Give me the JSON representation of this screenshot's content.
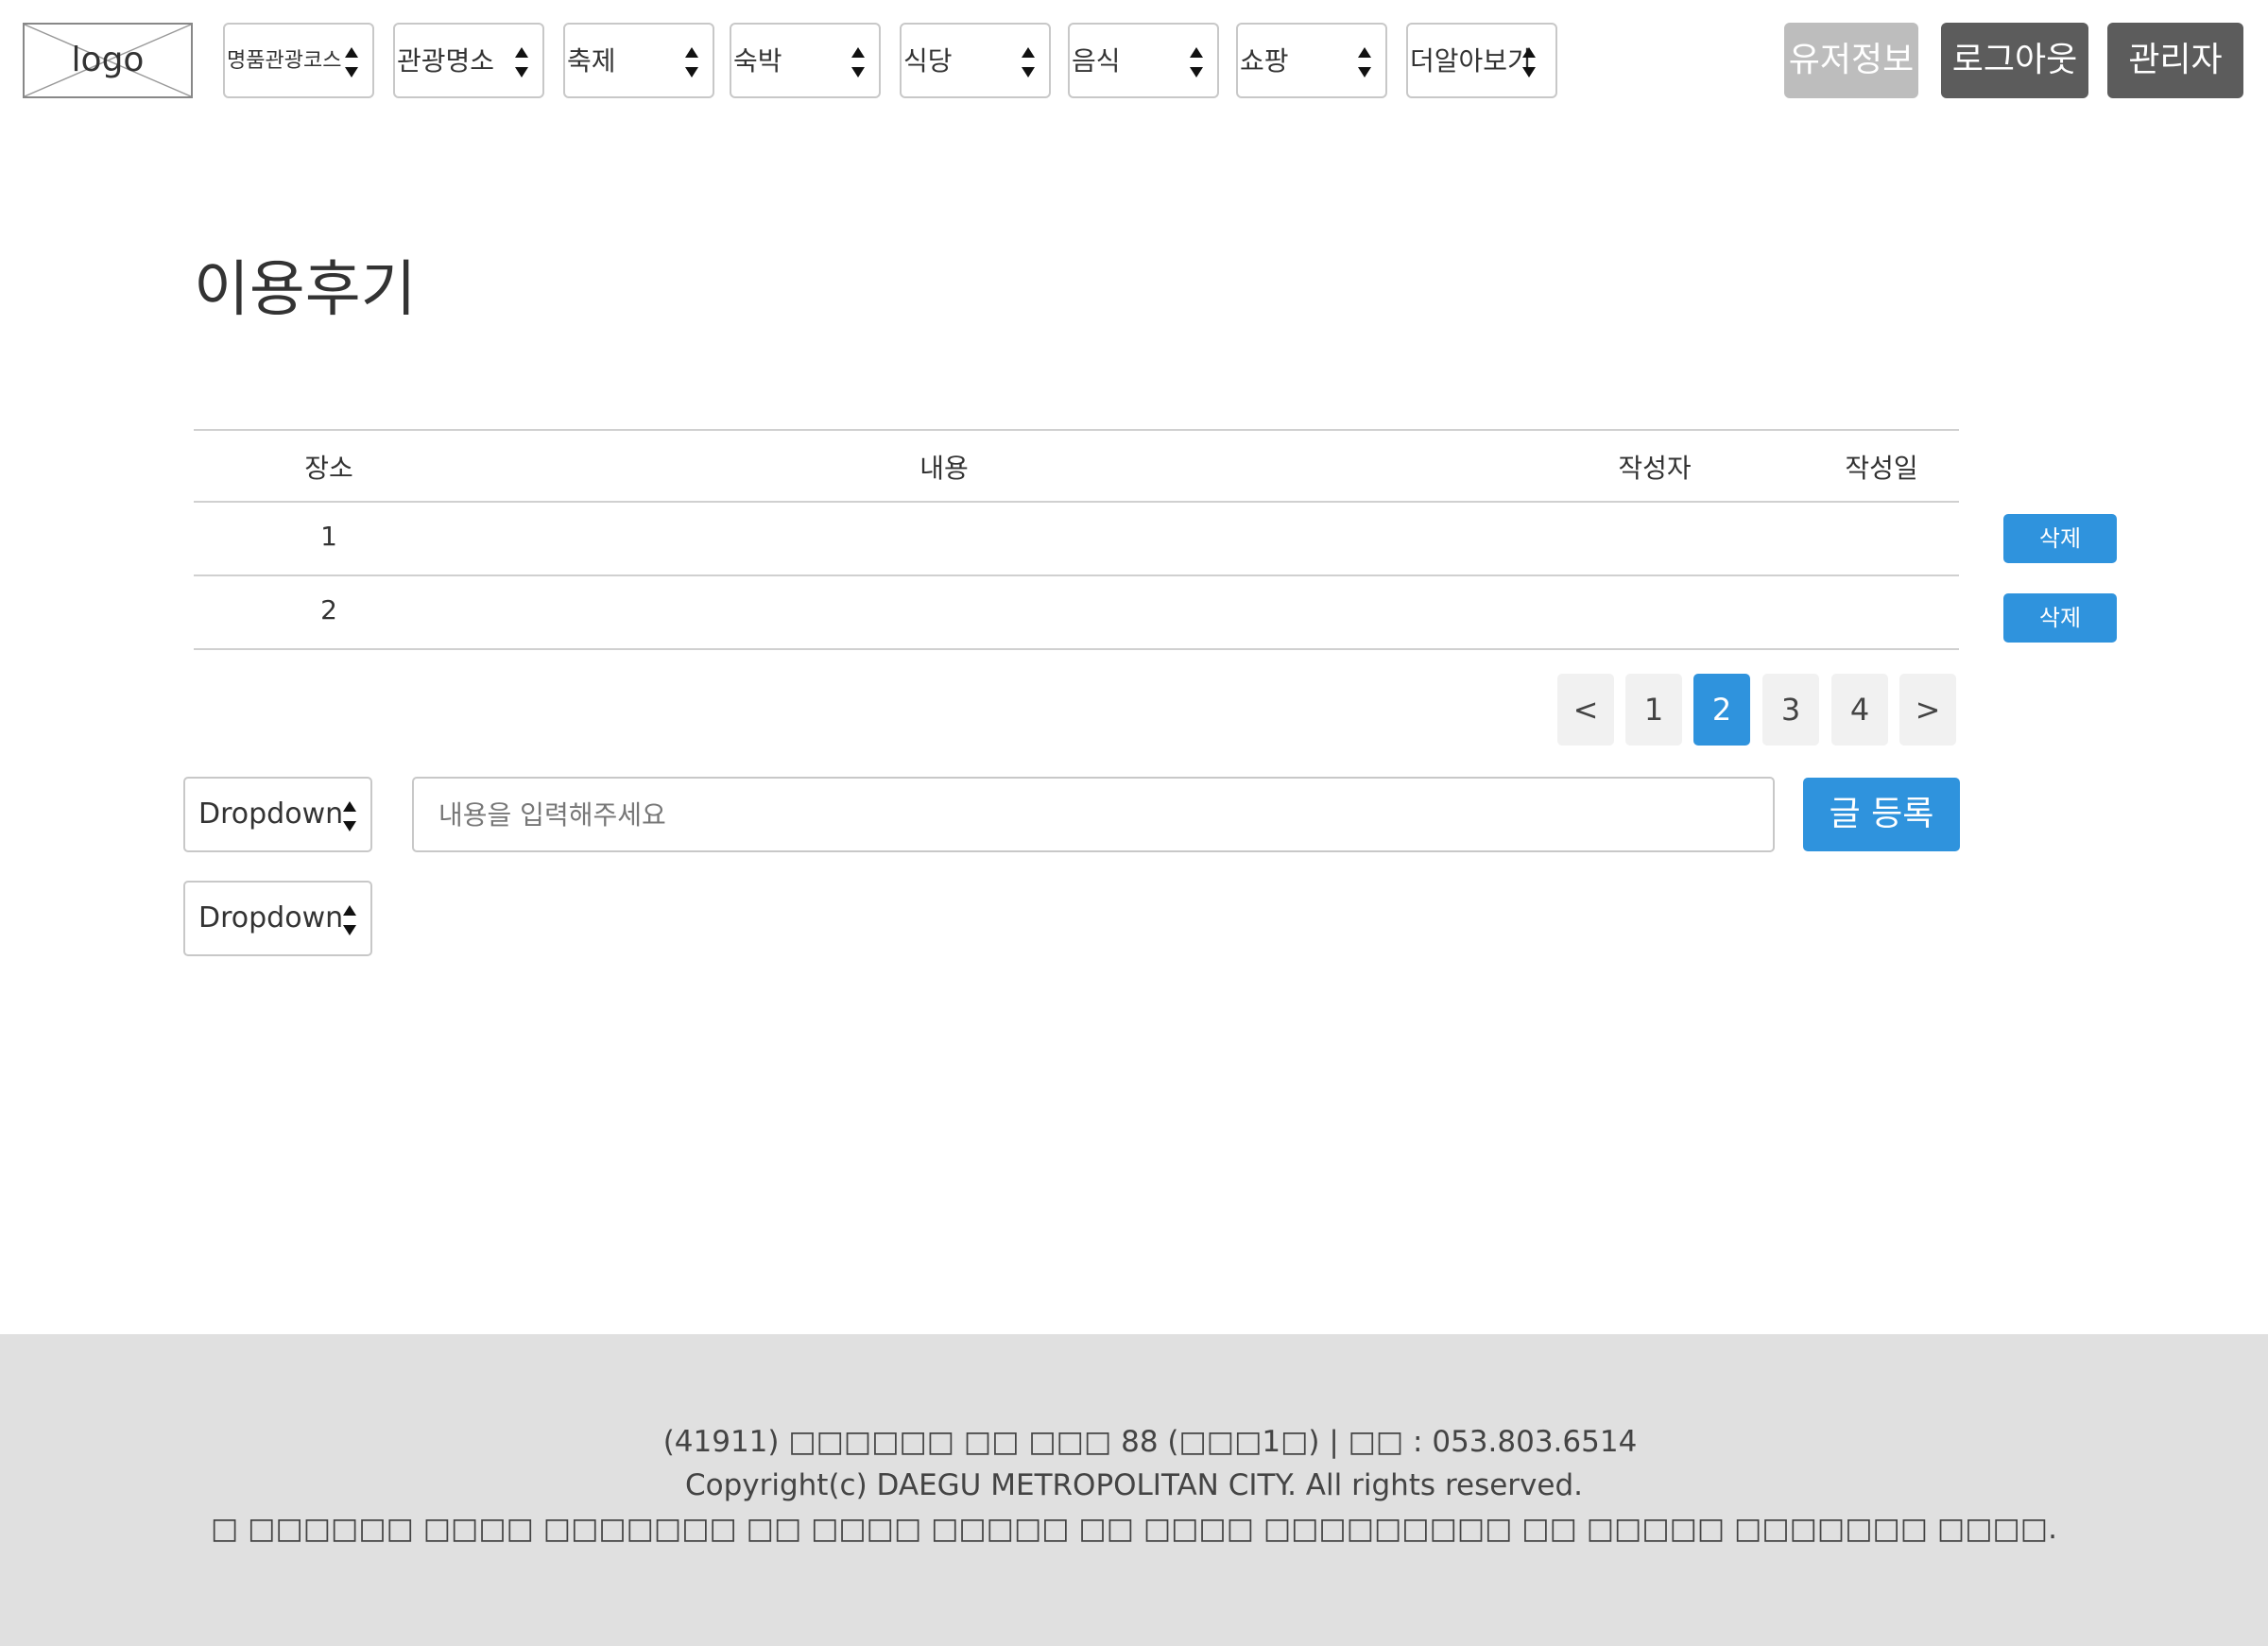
{
  "header": {
    "logo_text": "logo",
    "nav_selects": [
      {
        "label": "명품관광코스"
      },
      {
        "label": "관광명소"
      },
      {
        "label": "축제"
      },
      {
        "label": "숙박"
      },
      {
        "label": "식당"
      },
      {
        "label": "음식"
      },
      {
        "label": "쇼팡"
      },
      {
        "label": "더알아보기"
      }
    ],
    "user_info_label": "유저정보",
    "logout_label": "로그아웃",
    "admin_label": "관리자"
  },
  "main": {
    "title": "이용후기",
    "table": {
      "columns": [
        "장소",
        "내용",
        "작성자",
        "작성일"
      ],
      "rows": [
        {
          "place": "1",
          "content": "",
          "author": "",
          "date": "",
          "delete_label": "삭제"
        },
        {
          "place": "2",
          "content": "",
          "author": "",
          "date": "",
          "delete_label": "삭제"
        }
      ]
    },
    "pagination": {
      "prev": "<",
      "pages": [
        "1",
        "2",
        "3",
        "4"
      ],
      "current": "2",
      "next": ">"
    },
    "form": {
      "dropdown1": "Dropdown",
      "dropdown2": "Dropdown",
      "content_placeholder": "내용을 입력해주세요",
      "content_value": "",
      "submit_label": "글 등록"
    }
  },
  "footer": {
    "line1": "(41911) □□□□□□ □□ □□□ 88 (□□□1□) | □□ : 053.803.6514",
    "line2": "Copyright(c) DAEGU METROPOLITAN CITY. All rights reserved.",
    "line3": "□ □□□□□□ □□□□ □□□□□□□ □□ □□□□ □□□□□ □□ □□□□ □□□□□□□□□ □□ □□□□□ □□□□□□□ □□□□."
  },
  "colors": {
    "accent": "#2f93dd",
    "user_info_bg": "#bdbdbd",
    "dark_button_bg": "#5c5c5c",
    "footer_bg": "#e0e0e0"
  },
  "icons": {
    "select_arrows": "up-down-arrows-icon",
    "logo_placeholder": "image-placeholder-icon"
  }
}
